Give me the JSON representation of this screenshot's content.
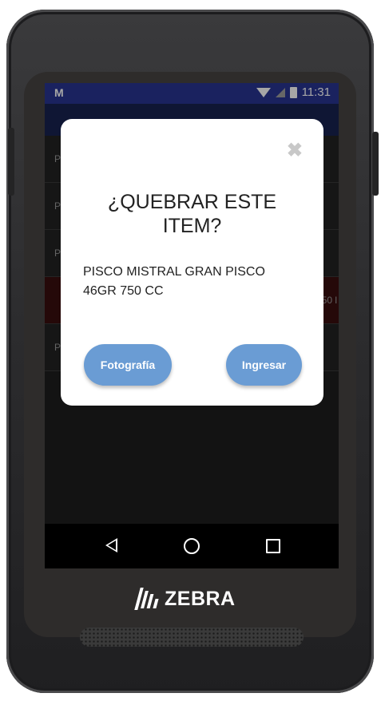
{
  "status_bar": {
    "app_icon": "M",
    "time": "11:31"
  },
  "list": {
    "rows": [
      {
        "left": "P",
        "right": ""
      },
      {
        "left": "P",
        "right": ""
      },
      {
        "left": "P",
        "right": ""
      },
      {
        "left": "",
        "right": "50 l"
      },
      {
        "left": "P",
        "right": ""
      }
    ]
  },
  "dialog": {
    "close_symbol": "✖",
    "title": "¿QUEBRAR ESTE ITEM?",
    "item_description": "PISCO MISTRAL GRAN PISCO 46GR 750 CC",
    "photo_button": "Fotografía",
    "submit_button": "Ingresar"
  },
  "device": {
    "brand": "ZEBRA"
  },
  "colors": {
    "status_bar": "#283593",
    "button": "#6a9cd4",
    "device_body": "#2b2b2d"
  }
}
